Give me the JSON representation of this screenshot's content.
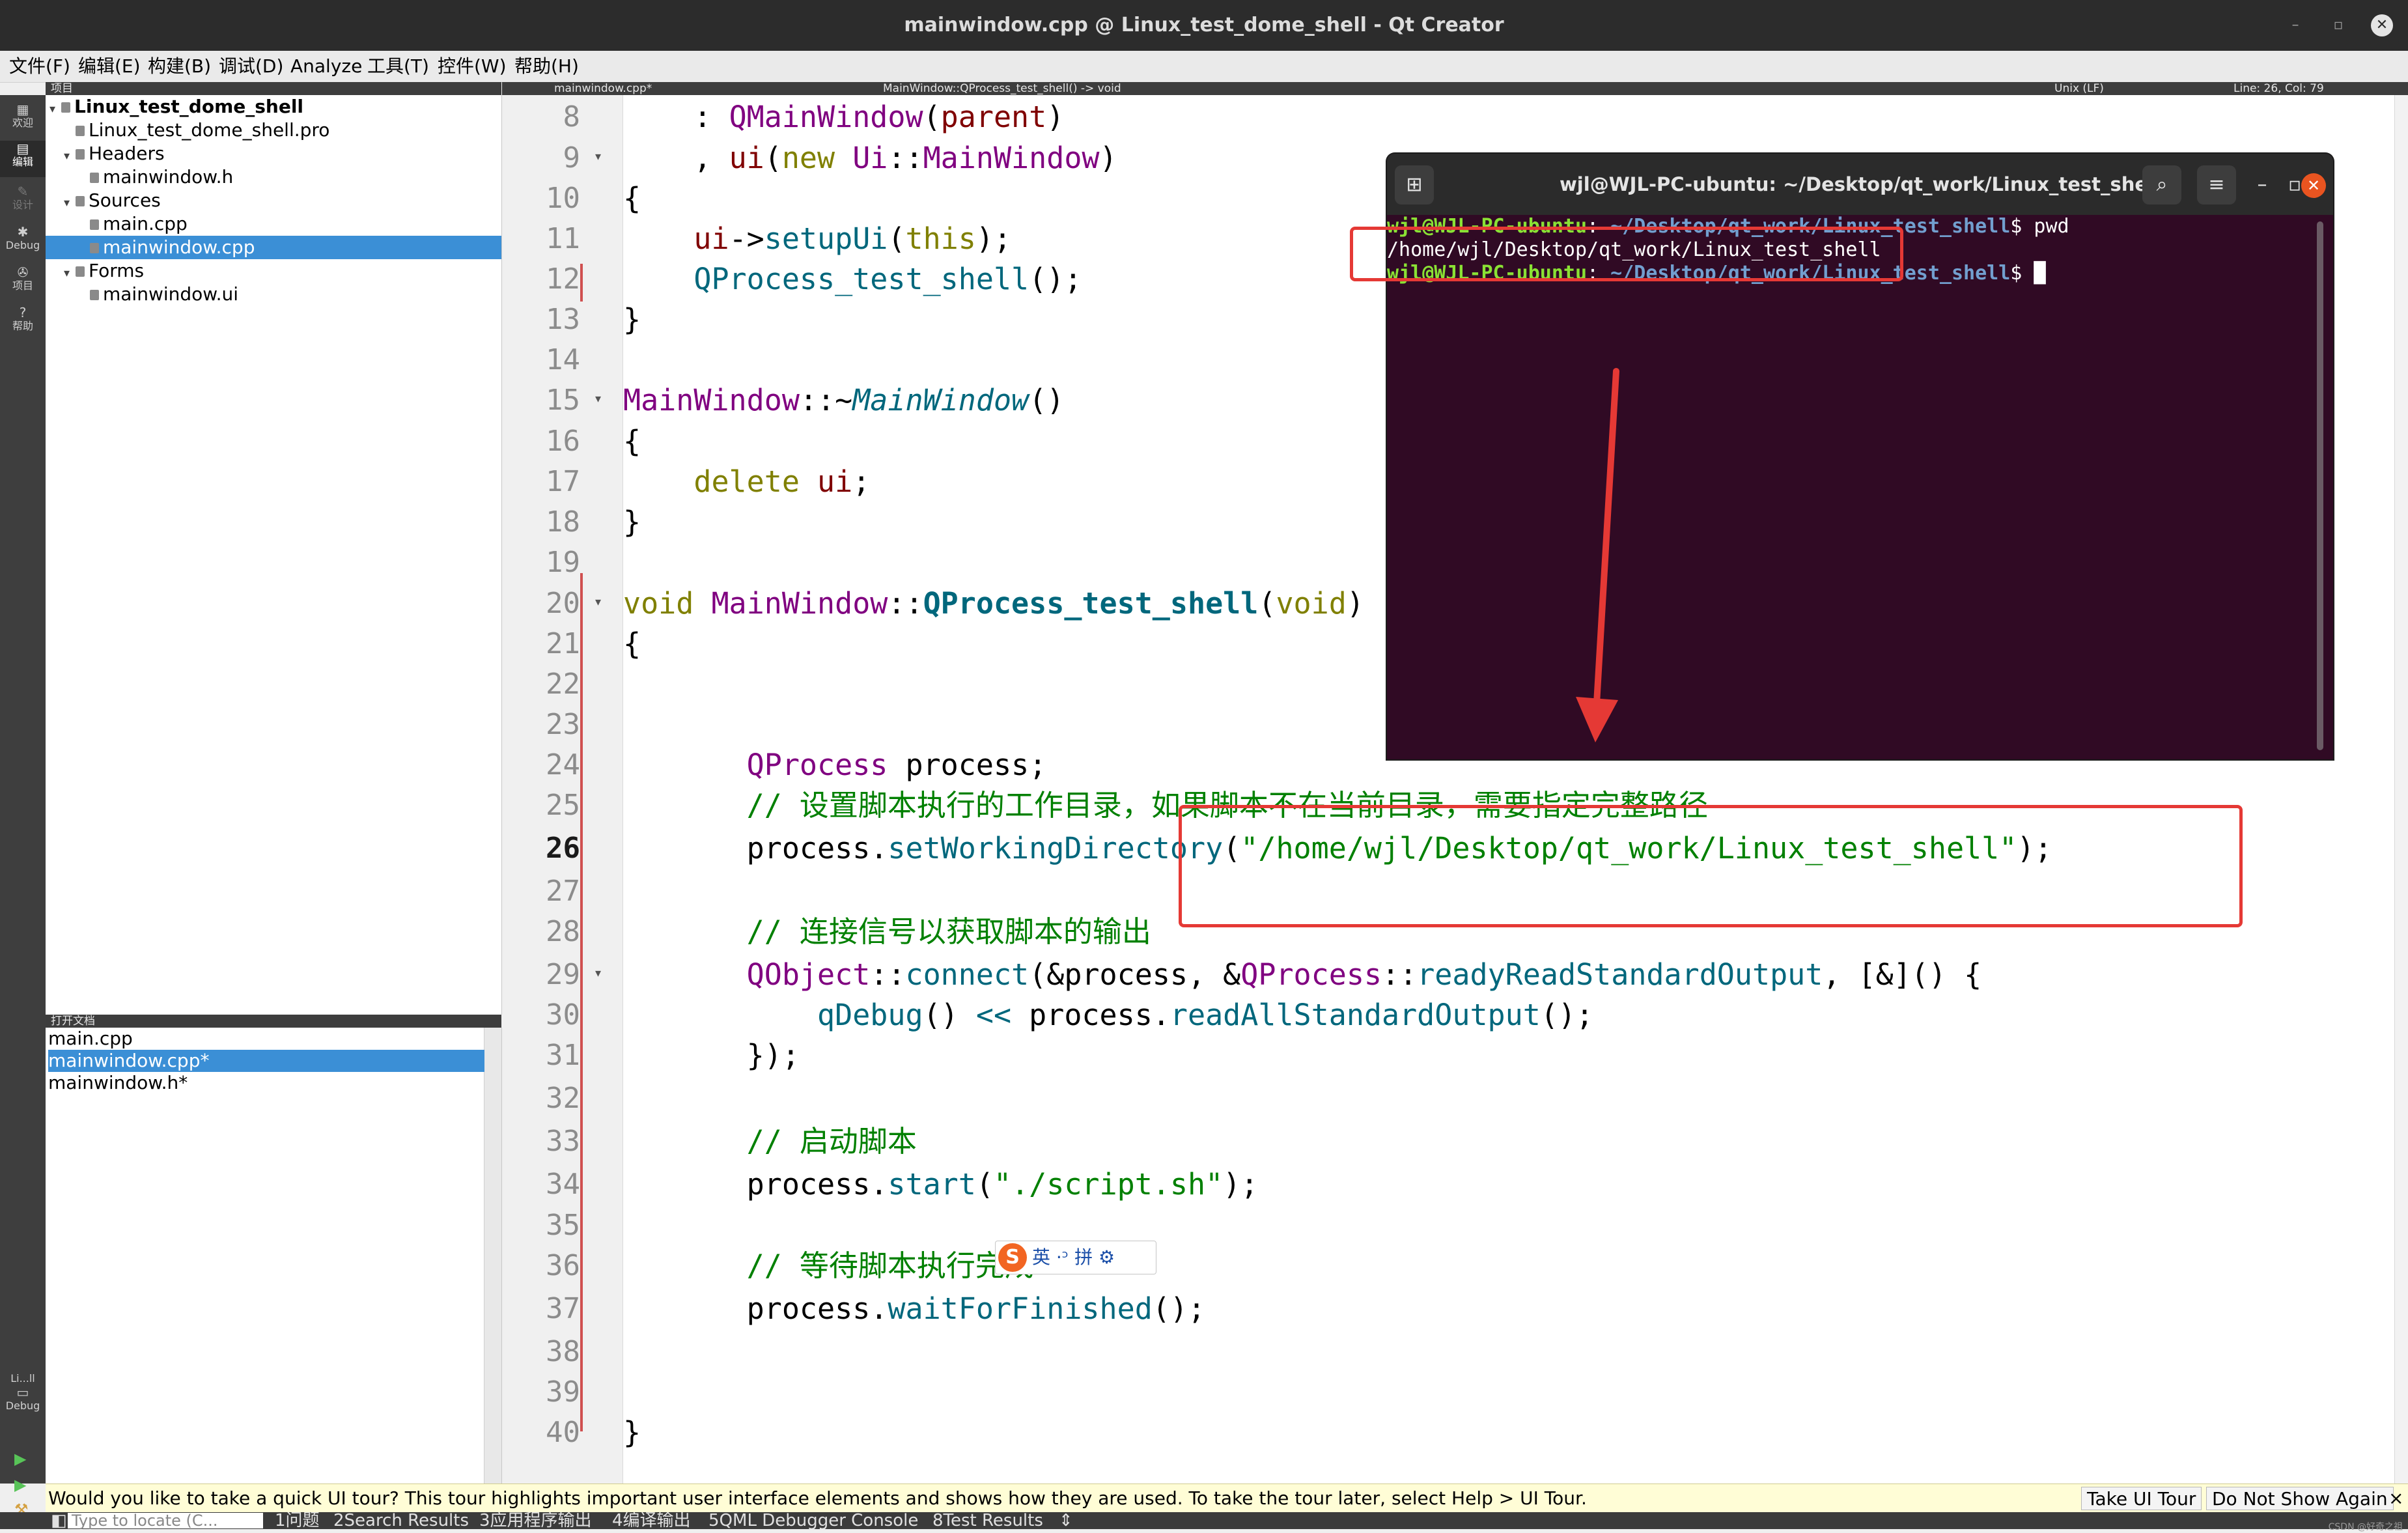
{
  "window": {
    "title": "mainwindow.cpp @ Linux_test_dome_shell - Qt Creator",
    "controls": {
      "minimize": "–",
      "restore": "▫",
      "close": "✕"
    }
  },
  "menu": [
    "文件(F)",
    "编辑(E)",
    "构建(B)",
    "调试(D)",
    "Analyze",
    "工具(T)",
    "控件(W)",
    "帮助(H)"
  ],
  "modes": {
    "welcome": {
      "label": "欢迎",
      "icon": "grid-icon"
    },
    "edit": {
      "label": "编辑",
      "icon": "edit-icon"
    },
    "design": {
      "label": "设计",
      "icon": "pen-icon"
    },
    "debug": {
      "label": "Debug",
      "icon": "bug-icon"
    },
    "projects": {
      "label": "项目",
      "icon": "wrench-icon"
    },
    "help": {
      "label": "帮助",
      "icon": "help-icon"
    },
    "kit": {
      "label": "Li...ll",
      "sublabel": "Debug",
      "icon": "monitor-icon"
    }
  },
  "project_panel": {
    "header": "项目",
    "tree": [
      {
        "label": "Linux_test_dome_shell",
        "level": 0,
        "arrow": "▾",
        "bold": true
      },
      {
        "label": "Linux_test_dome_shell.pro",
        "level": 1,
        "arrow": ""
      },
      {
        "label": "Headers",
        "level": 1,
        "arrow": "▾"
      },
      {
        "label": "mainwindow.h",
        "level": 2,
        "arrow": ""
      },
      {
        "label": "Sources",
        "level": 1,
        "arrow": "▾"
      },
      {
        "label": "main.cpp",
        "level": 2,
        "arrow": ""
      },
      {
        "label": "mainwindow.cpp",
        "level": 2,
        "arrow": "",
        "selected": true
      },
      {
        "label": "Forms",
        "level": 1,
        "arrow": "▾"
      },
      {
        "label": "mainwindow.ui",
        "level": 2,
        "arrow": ""
      }
    ]
  },
  "open_documents": {
    "header": "打开文档",
    "items": [
      {
        "label": "main.cpp"
      },
      {
        "label": "mainwindow.cpp*",
        "selected": true
      },
      {
        "label": "mainwindow.h*"
      }
    ]
  },
  "editor_header": {
    "file_tab": "mainwindow.cpp*",
    "symbol": "MainWindow::QProcess_test_shell() -> void",
    "line_ending": "Unix (LF)",
    "cursor": "Line: 26, Col: 79"
  },
  "editor": {
    "current_line": 26,
    "lines": [
      {
        "n": "8",
        "fold": ""
      },
      {
        "n": "9",
        "fold": "▾"
      },
      {
        "n": "10",
        "fold": ""
      },
      {
        "n": "11",
        "fold": ""
      },
      {
        "n": "12",
        "fold": ""
      },
      {
        "n": "13",
        "fold": ""
      },
      {
        "n": "14",
        "fold": ""
      },
      {
        "n": "15",
        "fold": "▾"
      },
      {
        "n": "16",
        "fold": ""
      },
      {
        "n": "17",
        "fold": ""
      },
      {
        "n": "18",
        "fold": ""
      },
      {
        "n": "19",
        "fold": ""
      },
      {
        "n": "20",
        "fold": "▾"
      },
      {
        "n": "21",
        "fold": ""
      },
      {
        "n": "22",
        "fold": ""
      },
      {
        "n": "23",
        "fold": ""
      },
      {
        "n": "24",
        "fold": ""
      },
      {
        "n": "25",
        "fold": ""
      },
      {
        "n": "26",
        "fold": ""
      },
      {
        "n": "27",
        "fold": ""
      },
      {
        "n": "28",
        "fold": ""
      },
      {
        "n": "29",
        "fold": "▾"
      },
      {
        "n": "30",
        "fold": ""
      },
      {
        "n": "31",
        "fold": ""
      },
      {
        "n": "32",
        "fold": ""
      },
      {
        "n": "33",
        "fold": ""
      },
      {
        "n": "34",
        "fold": ""
      },
      {
        "n": "35",
        "fold": ""
      },
      {
        "n": "36",
        "fold": ""
      },
      {
        "n": "37",
        "fold": ""
      },
      {
        "n": "38",
        "fold": ""
      },
      {
        "n": "39",
        "fold": ""
      },
      {
        "n": "40",
        "fold": ""
      }
    ],
    "code": {
      "l8": [
        [
          "    : ",
          ""
        ],
        [
          "QMainWindow",
          "ty"
        ],
        [
          "(",
          ""
        ],
        [
          "parent",
          "fi"
        ],
        [
          ")",
          ""
        ]
      ],
      "l9": [
        [
          "    , ",
          ""
        ],
        [
          "ui",
          "fi"
        ],
        [
          "(",
          ""
        ],
        [
          "new",
          "kw"
        ],
        [
          " ",
          ""
        ],
        [
          "Ui",
          "ty"
        ],
        [
          "::",
          ""
        ],
        [
          "MainWindow",
          "ty"
        ],
        [
          ")",
          ""
        ]
      ],
      "l10": [
        [
          "{",
          ""
        ]
      ],
      "l11": [
        [
          "    ",
          ""
        ],
        [
          "ui",
          "fi"
        ],
        [
          "->",
          ""
        ],
        [
          "setupUi",
          "fn"
        ],
        [
          "(",
          ""
        ],
        [
          "this",
          "kw"
        ],
        [
          ");",
          ""
        ]
      ],
      "l12": [
        [
          "    ",
          ""
        ],
        [
          "QProcess_test_shell",
          "fn"
        ],
        [
          "();",
          ""
        ]
      ],
      "l13": [
        [
          "}",
          ""
        ]
      ],
      "l14": [],
      "l15": [
        [
          "MainWindow",
          "ty"
        ],
        [
          "::~",
          ""
        ],
        [
          "MainWindow",
          "it"
        ],
        [
          "()",
          ""
        ]
      ],
      "l16": [
        [
          "{",
          ""
        ]
      ],
      "l17": [
        [
          "    ",
          ""
        ],
        [
          "delete",
          "kw"
        ],
        [
          " ",
          ""
        ],
        [
          "ui",
          "fi"
        ],
        [
          ";",
          ""
        ]
      ],
      "l18": [
        [
          "}",
          ""
        ]
      ],
      "l19": [],
      "l20": [
        [
          "void",
          "kw"
        ],
        [
          " ",
          ""
        ],
        [
          "MainWindow",
          "ty"
        ],
        [
          "::",
          ""
        ],
        [
          "QProcess_test_shell",
          "fnb"
        ],
        [
          "(",
          ""
        ],
        [
          "void",
          "kw"
        ],
        [
          ")",
          ""
        ]
      ],
      "l21": [
        [
          "{",
          ""
        ]
      ],
      "l22": [],
      "l23": [],
      "l24": [
        [
          "       ",
          ""
        ],
        [
          "QProcess",
          "ty"
        ],
        [
          " ",
          ""
        ],
        [
          "process",
          ""
        ],
        [
          ";",
          ""
        ]
      ],
      "l25": [
        [
          "       ",
          ""
        ],
        [
          "// 设置脚本执行的工作目录，如果脚本不在当前目录，需要指定完整路径",
          "cm"
        ]
      ],
      "l26": [
        [
          "       ",
          ""
        ],
        [
          "process",
          ""
        ],
        [
          ".",
          ""
        ],
        [
          "setWorkingDirectory",
          "fn"
        ],
        [
          "(",
          ""
        ],
        [
          "\"/home/wjl/Desktop/qt_work/Linux_test_shell\"",
          "st"
        ],
        [
          ");",
          ""
        ]
      ],
      "l27": [],
      "l28": [
        [
          "       ",
          ""
        ],
        [
          "// 连接信号以获取脚本的输出",
          "cm"
        ]
      ],
      "l29": [
        [
          "       ",
          ""
        ],
        [
          "QObject",
          "ty"
        ],
        [
          "::",
          ""
        ],
        [
          "connect",
          "fn"
        ],
        [
          "(&",
          ""
        ],
        [
          "process",
          ""
        ],
        [
          ", &",
          ""
        ],
        [
          "QProcess",
          "ty"
        ],
        [
          "::",
          ""
        ],
        [
          "readyReadStandardOutput",
          "fn"
        ],
        [
          ", [&]() {",
          ""
        ]
      ],
      "l30": [
        [
          "           ",
          ""
        ],
        [
          "qDebug",
          "fn"
        ],
        [
          "() ",
          ""
        ],
        [
          "<<",
          "fn"
        ],
        [
          " ",
          ""
        ],
        [
          "process",
          ""
        ],
        [
          ".",
          ""
        ],
        [
          "readAllStandardOutput",
          "fn"
        ],
        [
          "();",
          ""
        ]
      ],
      "l31": [
        [
          "       ",
          ""
        ],
        [
          "});",
          ""
        ]
      ],
      "l32": [],
      "l33": [
        [
          "       ",
          ""
        ],
        [
          "// 启动脚本",
          "cm"
        ]
      ],
      "l34": [
        [
          "       ",
          ""
        ],
        [
          "process",
          ""
        ],
        [
          ".",
          ""
        ],
        [
          "start",
          "fn"
        ],
        [
          "(",
          ""
        ],
        [
          "\"./script.sh\"",
          "st"
        ],
        [
          ");",
          ""
        ]
      ],
      "l35": [],
      "l36": [
        [
          "       ",
          ""
        ],
        [
          "// 等待脚本执行完成",
          "cm"
        ]
      ],
      "l37": [
        [
          "       ",
          ""
        ],
        [
          "process",
          ""
        ],
        [
          ".",
          ""
        ],
        [
          "waitForFinished",
          "fn"
        ],
        [
          "();",
          ""
        ]
      ],
      "l38": [],
      "l39": [],
      "l40": [
        [
          "}",
          ""
        ]
      ]
    }
  },
  "terminal": {
    "title": "wjl@WJL-PC-ubuntu: ~/Desktop/qt_work/Linux_test_shell",
    "prompt_user": "wjl@WJL-PC-ubuntu",
    "prompt_sep": ":",
    "prompt_path": " ~/Desktop/qt_work/Linux_test_shell",
    "prompt_end": "$ ",
    "command": "pwd",
    "output": "/home/wjl/Desktop/qt_work/Linux_test_shell",
    "new_tab_icon": "⊞",
    "search_icon": "⌕",
    "menu_icon": "≡",
    "minimize": "–",
    "maximize": "▫",
    "close": "✕",
    "cursor": "█"
  },
  "annotation": {
    "color": "#e53935"
  },
  "ime": {
    "logo": "S",
    "text": "英 ·ᵓ 拼 ⚙"
  },
  "tour": {
    "message": "Would you like to take a quick UI tour? This tour highlights important user interface elements and shows how they are used. To take the tour later, select Help > UI Tour.",
    "take_label": "Take UI Tour",
    "dismiss_label": "Do Not Show Again",
    "close": "×"
  },
  "statusbar": {
    "locator_placeholder": "Type to locate (C...",
    "panes": [
      "1问题",
      "2Search Results",
      "3应用程序输出",
      "4编译输出",
      "5QML Debugger Console",
      "8Test Results"
    ],
    "more": "⇕"
  },
  "watermark": "CSDN @好奇之祖",
  "colors": {
    "selection": "#3b8fd6",
    "terminal_bg": "#300a24",
    "tour_bg": "#fffdd6"
  }
}
